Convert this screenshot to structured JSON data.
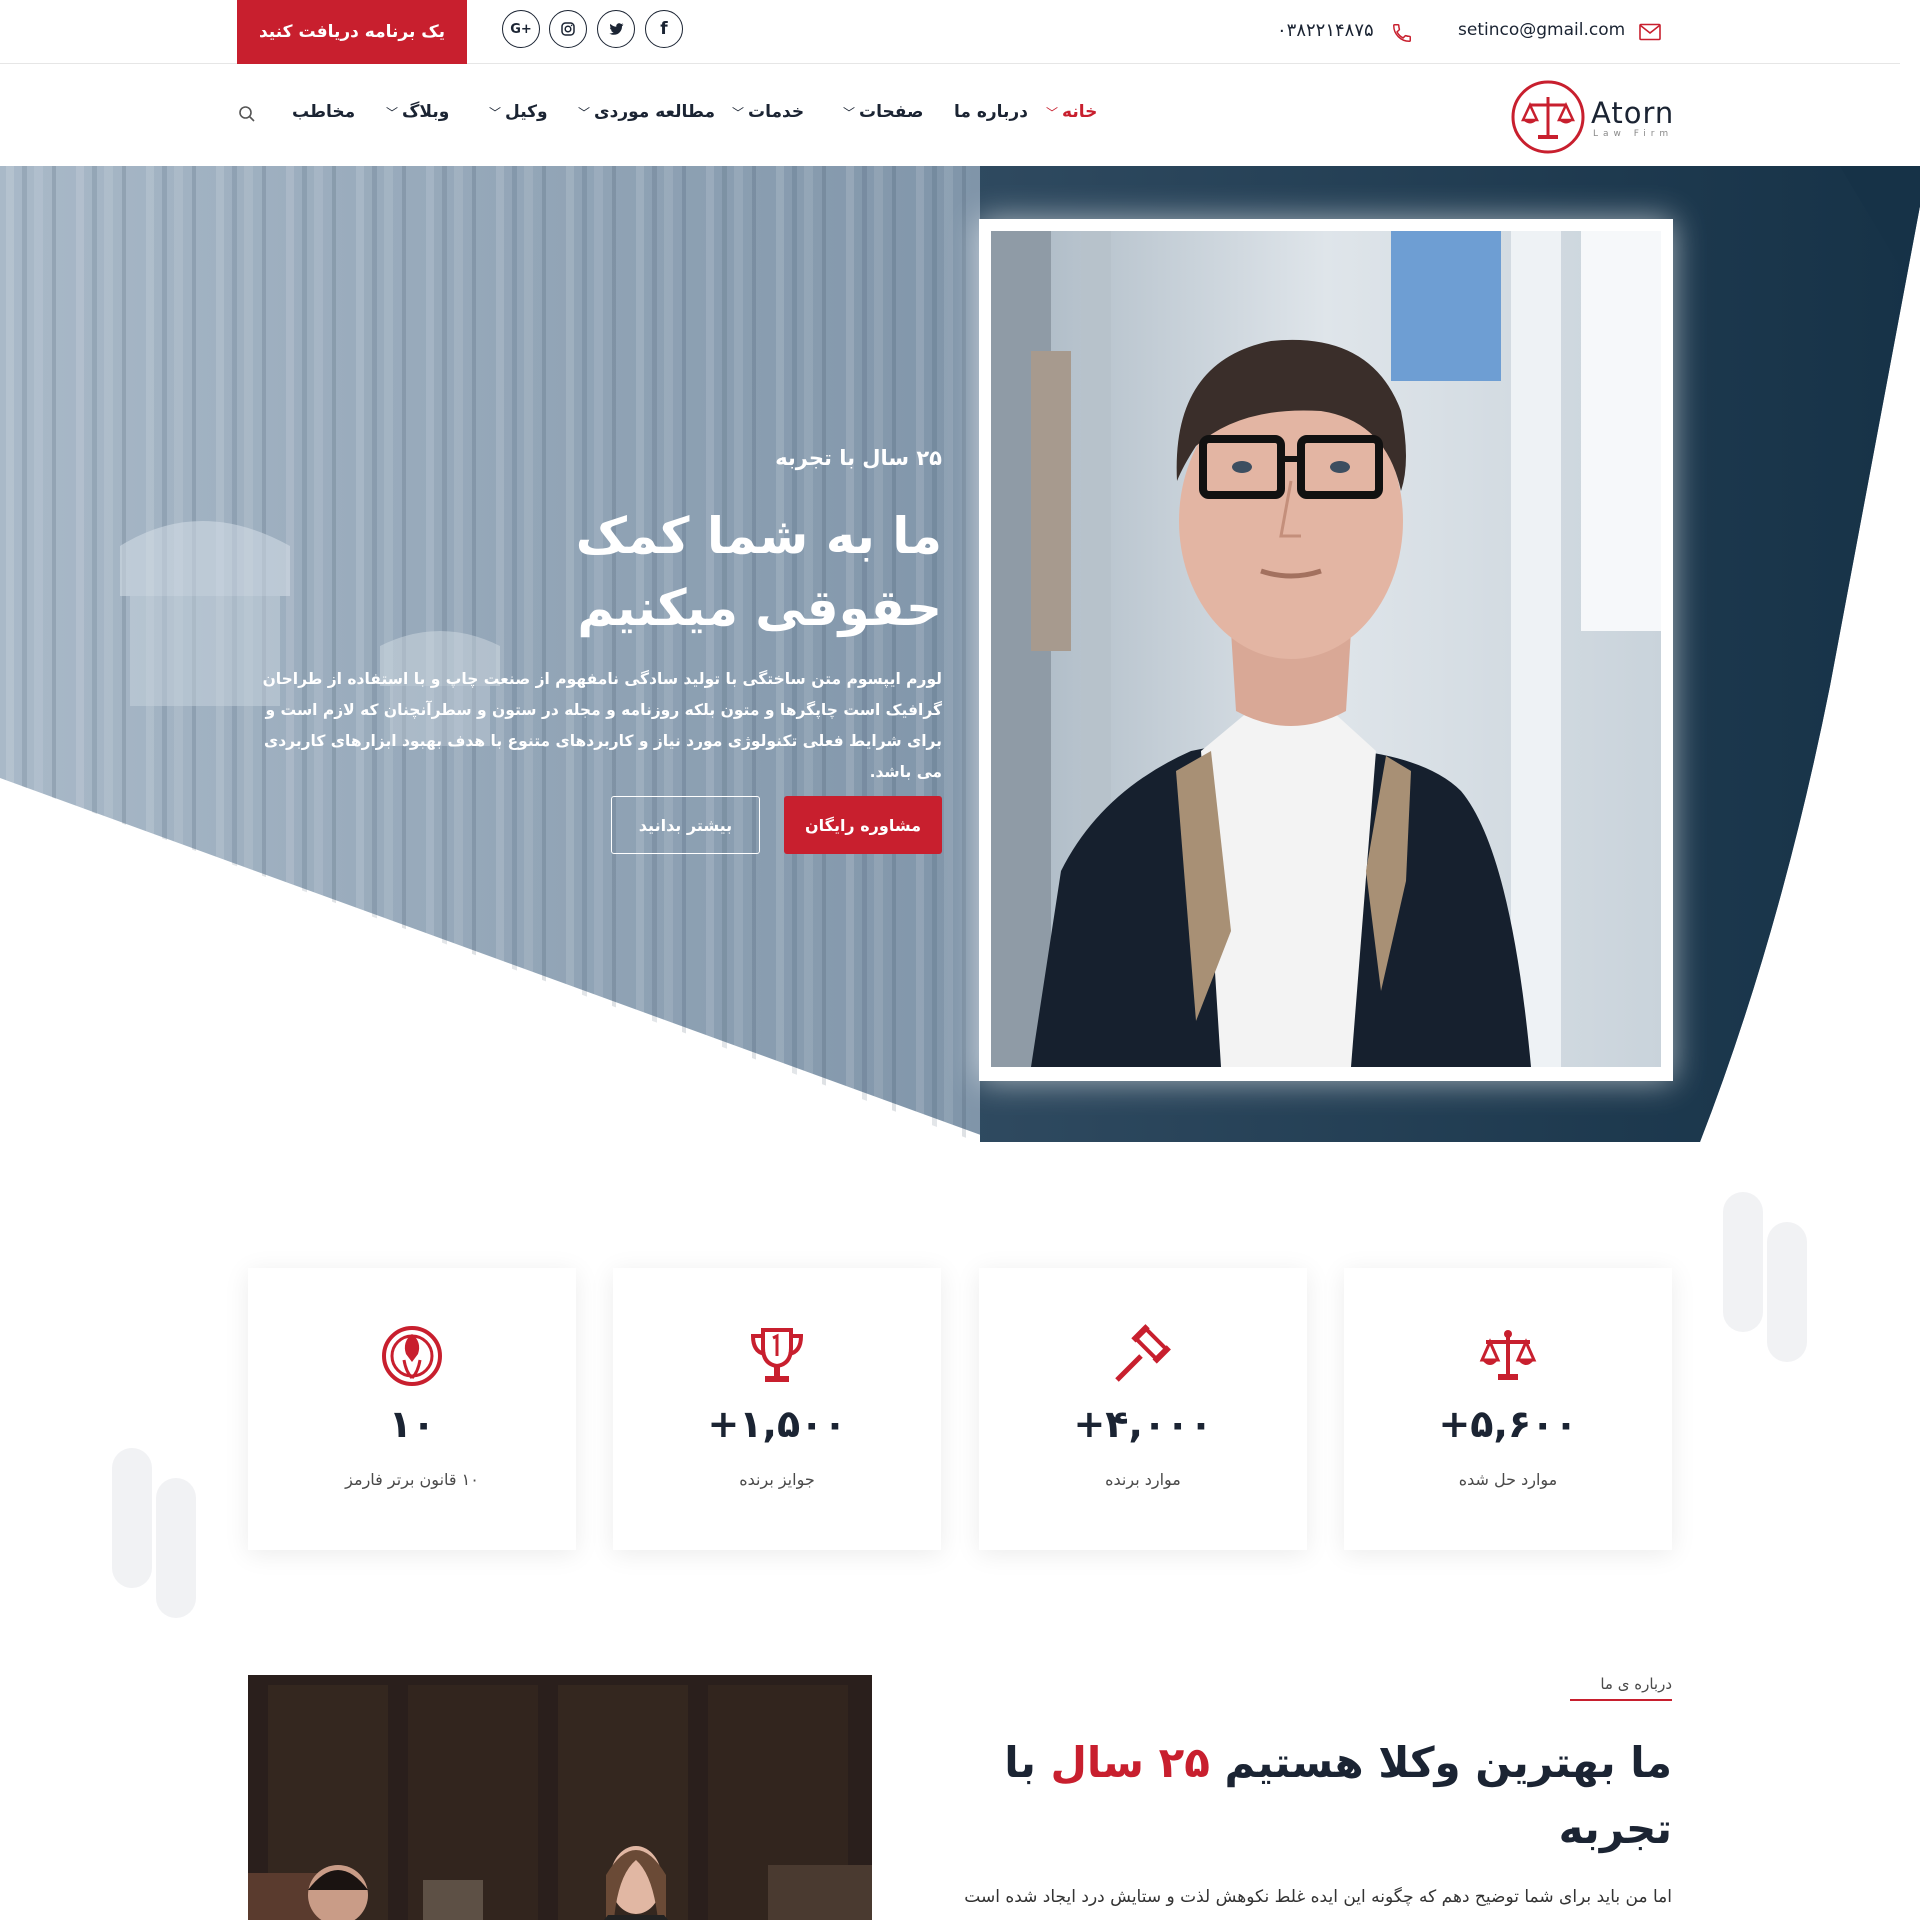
{
  "topbar": {
    "appointment_label": "یک برنامه دریافت کنید",
    "email": "setinco@gmail.com",
    "phone": "۰۳۸۲۲۱۴۸۷۵",
    "social": [
      {
        "icon": "google-plus-icon",
        "label": "G+"
      },
      {
        "icon": "instagram-icon",
        "label": ""
      },
      {
        "icon": "twitter-icon",
        "label": ""
      },
      {
        "icon": "facebook-icon",
        "label": "f"
      }
    ]
  },
  "nav": {
    "logo_name": "Atorn",
    "logo_sub": "Law Firm",
    "items": [
      {
        "label": "خانه",
        "dropdown": true,
        "active": true
      },
      {
        "label": "درباره ما",
        "dropdown": false
      },
      {
        "label": "صفحات",
        "dropdown": true
      },
      {
        "label": "خدمات",
        "dropdown": true
      },
      {
        "label": "مطالعه موردی",
        "dropdown": true
      },
      {
        "label": "وکیل",
        "dropdown": true
      },
      {
        "label": "وبلاگ",
        "dropdown": true
      },
      {
        "label": "مخاطب",
        "dropdown": false
      }
    ],
    "search_icon": "search-icon"
  },
  "hero": {
    "experience": "۲۵ سال با تجربه",
    "title": "ما به شما کمک حقوقی میکنیم",
    "description": "لورم ایپسوم متن ساختگی با تولید سادگی نامفهوم از صنعت چاپ و با استفاده از طراحان گرافیک است چاپگرها و متون بلکه روزنامه و مجله در ستون و سطرآنچنان که لازم است و برای شرایط فعلی تکنولوژی مورد نیاز و کاربردهای متنوع با هدف بهبود ابزارهای کاربردی می باشد.",
    "primary_button": "مشاوره رایگان",
    "secondary_button": "بیشتر بدانید"
  },
  "stats": [
    {
      "icon": "scales-icon",
      "value": "+۵,۶۰۰",
      "label": "موارد حل شده"
    },
    {
      "icon": "gavel-icon",
      "value": "+۴,۰۰۰",
      "label": "موارد برنده"
    },
    {
      "icon": "trophy-icon",
      "value": "+۱,۵۰۰",
      "label": "جوایز برنده"
    },
    {
      "icon": "award-icon",
      "value": "۱۰",
      "label": "۱۰ قانون برتر فارمز"
    }
  ],
  "about": {
    "tag": "درباره ی ما",
    "title_before": "ما بهترین وکلا هستیم ",
    "title_highlight": "۲۵ سال",
    "title_after": " با تجربه",
    "text": "اما من باید برای شما توضیح دهم که چگونه این ایده غلط نکوهش لذت و ستایش درد ایجاد شده است"
  },
  "colors": {
    "accent": "#c81f2e",
    "navy": "#1b3347",
    "text": "#1b2433"
  }
}
